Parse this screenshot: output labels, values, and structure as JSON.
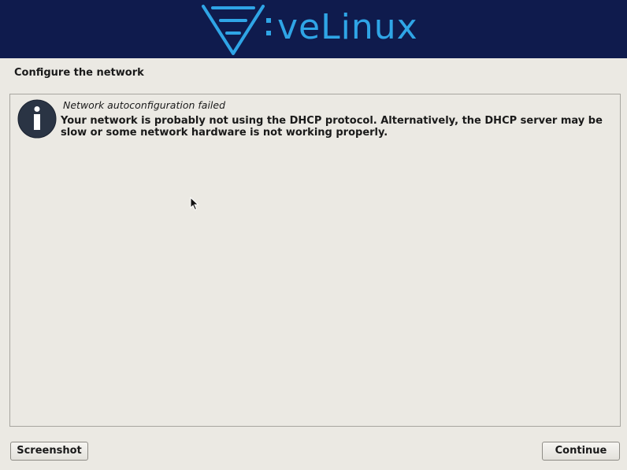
{
  "header": {
    "logo_text": "veLinux",
    "brand_color": "#2fa5e6",
    "banner_color": "#0f1b4d"
  },
  "step": {
    "title": "Configure the network"
  },
  "message": {
    "icon": "info-icon",
    "heading": "Network autoconfiguration failed",
    "body": "Your network is probably not using the DHCP protocol. Alternatively, the DHCP server may be slow or some network hardware is not working properly."
  },
  "buttons": {
    "screenshot_label": "Screenshot",
    "continue_label": "Continue"
  }
}
